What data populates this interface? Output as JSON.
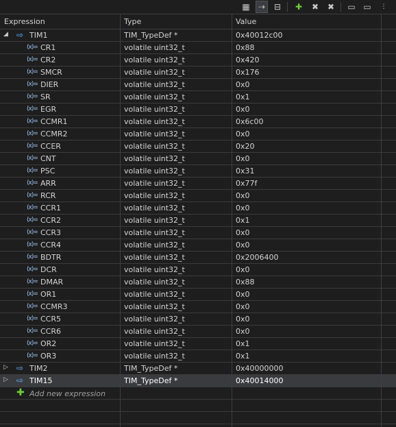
{
  "toolbar": {
    "icons": [
      "show-type-names-icon",
      "link-with-selection-icon",
      "collapse-all-icon",
      "add-expression-icon",
      "remove-expression-icon",
      "remove-all-expressions-icon",
      "new-folder-icon",
      "export-icon",
      "view-menu-icon"
    ]
  },
  "columns": {
    "expression": "Expression",
    "type": "Type",
    "value": "Value"
  },
  "rows": [
    {
      "name": "TIM1",
      "type": "TIM_TypeDef *",
      "value": "0x40012c00"
    },
    {
      "name": "CR1",
      "type": "volatile uint32_t",
      "value": "0x88"
    },
    {
      "name": "CR2",
      "type": "volatile uint32_t",
      "value": "0x420"
    },
    {
      "name": "SMCR",
      "type": "volatile uint32_t",
      "value": "0x176"
    },
    {
      "name": "DIER",
      "type": "volatile uint32_t",
      "value": "0x0"
    },
    {
      "name": "SR",
      "type": "volatile uint32_t",
      "value": "0x1"
    },
    {
      "name": "EGR",
      "type": "volatile uint32_t",
      "value": "0x0"
    },
    {
      "name": "CCMR1",
      "type": "volatile uint32_t",
      "value": "0x6c00"
    },
    {
      "name": "CCMR2",
      "type": "volatile uint32_t",
      "value": "0x0"
    },
    {
      "name": "CCER",
      "type": "volatile uint32_t",
      "value": "0x20"
    },
    {
      "name": "CNT",
      "type": "volatile uint32_t",
      "value": "0x0"
    },
    {
      "name": "PSC",
      "type": "volatile uint32_t",
      "value": "0x31"
    },
    {
      "name": "ARR",
      "type": "volatile uint32_t",
      "value": "0x77f"
    },
    {
      "name": "RCR",
      "type": "volatile uint32_t",
      "value": "0x0"
    },
    {
      "name": "CCR1",
      "type": "volatile uint32_t",
      "value": "0x0"
    },
    {
      "name": "CCR2",
      "type": "volatile uint32_t",
      "value": "0x1"
    },
    {
      "name": "CCR3",
      "type": "volatile uint32_t",
      "value": "0x0"
    },
    {
      "name": "CCR4",
      "type": "volatile uint32_t",
      "value": "0x0"
    },
    {
      "name": "BDTR",
      "type": "volatile uint32_t",
      "value": "0x2006400"
    },
    {
      "name": "DCR",
      "type": "volatile uint32_t",
      "value": "0x0"
    },
    {
      "name": "DMAR",
      "type": "volatile uint32_t",
      "value": "0x88"
    },
    {
      "name": "OR1",
      "type": "volatile uint32_t",
      "value": "0x0"
    },
    {
      "name": "CCMR3",
      "type": "volatile uint32_t",
      "value": "0x0"
    },
    {
      "name": "CCR5",
      "type": "volatile uint32_t",
      "value": "0x0"
    },
    {
      "name": "CCR6",
      "type": "volatile uint32_t",
      "value": "0x0"
    },
    {
      "name": "OR2",
      "type": "volatile uint32_t",
      "value": "0x1"
    },
    {
      "name": "OR3",
      "type": "volatile uint32_t",
      "value": "0x1"
    },
    {
      "name": "TIM2",
      "type": "TIM_TypeDef *",
      "value": "0x40000000"
    },
    {
      "name": "TIM15",
      "type": "TIM_TypeDef *",
      "value": "0x40014000"
    }
  ],
  "add_new": "Add new expression"
}
